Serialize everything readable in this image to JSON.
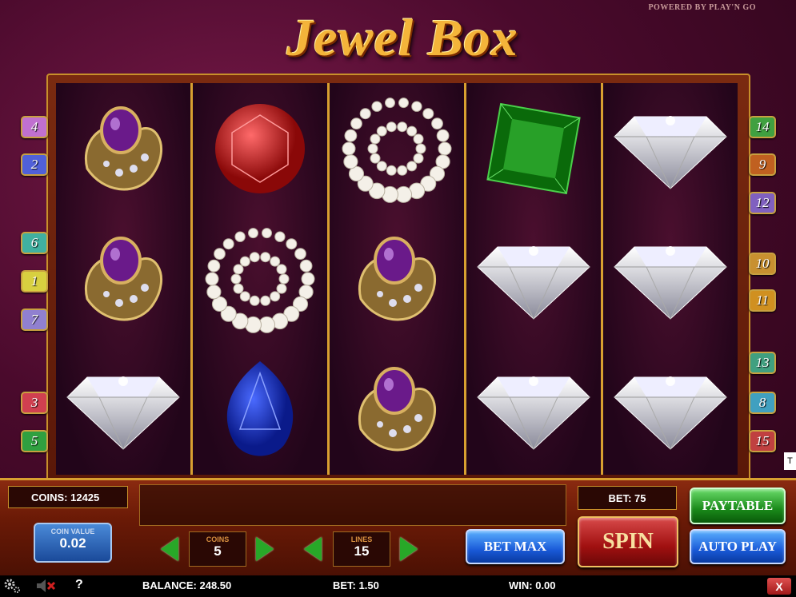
{
  "header": {
    "powered_by": "POWERED BY PLAY'N GO",
    "logo": "Jewel Box"
  },
  "reels": [
    [
      "purple-brooch",
      "purple-brooch",
      "diamond"
    ],
    [
      "ruby",
      "pearl-necklace",
      "sapphire"
    ],
    [
      "pearl-necklace",
      "purple-brooch",
      "purple-brooch"
    ],
    [
      "emerald",
      "diamond",
      "diamond"
    ],
    [
      "diamond",
      "diamond",
      "diamond"
    ]
  ],
  "paylines_left": [
    {
      "n": "4",
      "color": "#c070d0"
    },
    {
      "n": "2",
      "color": "#5060d8"
    },
    {
      "n": "6",
      "color": "#40b0a0"
    },
    {
      "n": "1",
      "color": "#d8d040"
    },
    {
      "n": "7",
      "color": "#9080d0"
    },
    {
      "n": "3",
      "color": "#d04050"
    },
    {
      "n": "5",
      "color": "#30a040"
    }
  ],
  "paylines_right": [
    {
      "n": "14",
      "color": "#40a040"
    },
    {
      "n": "9",
      "color": "#c06020"
    },
    {
      "n": "12",
      "color": "#8060c0"
    },
    {
      "n": "10",
      "color": "#c89030"
    },
    {
      "n": "11",
      "color": "#d09020"
    },
    {
      "n": "13",
      "color": "#40a080"
    },
    {
      "n": "8",
      "color": "#40a0c0"
    },
    {
      "n": "15",
      "color": "#c04040"
    }
  ],
  "panel": {
    "coins": "COINS: 12425",
    "bet_display": "BET: 75",
    "coin_value_label": "COIN VALUE",
    "coin_value": "0.02",
    "coins_label": "COINS",
    "coins_value": "5",
    "lines_label": "LINES",
    "lines_value": "15",
    "bet_max": "BET MAX",
    "spin": "SPIN",
    "paytable": "PAYTABLE",
    "auto_play": "AUTO PLAY"
  },
  "status": {
    "balance": "BALANCE: 248.50",
    "bet": "BET: 1.50",
    "win": "WIN: 0.00",
    "help": "?",
    "close": "X",
    "tooltip": "T"
  }
}
